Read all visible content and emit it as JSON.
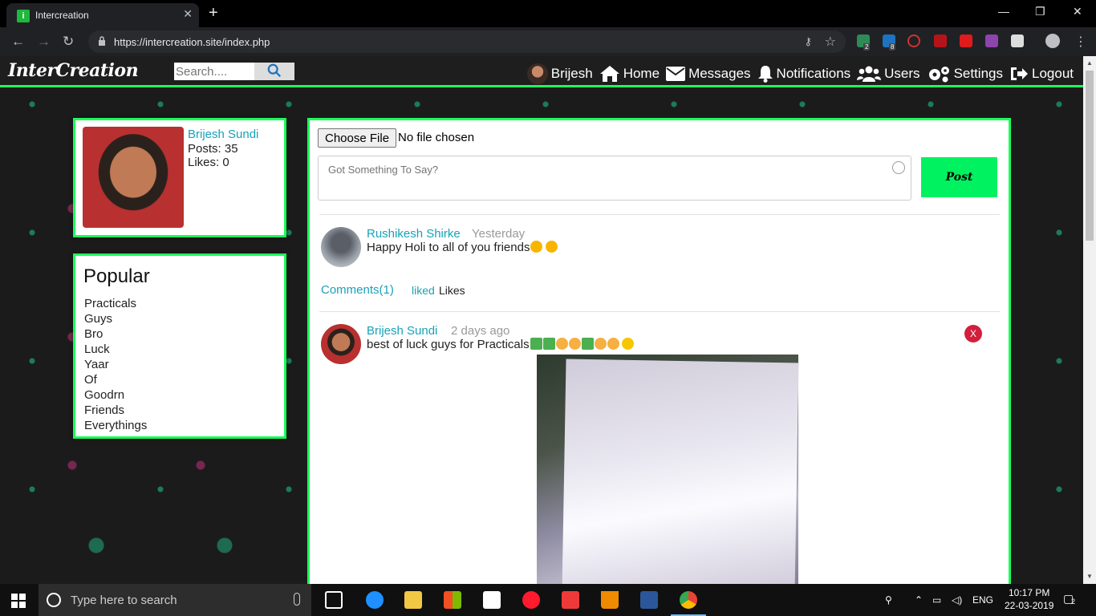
{
  "browser": {
    "tab_title": "Intercreation",
    "favicon_letter": "i",
    "url": "https://intercreation.site/index.php",
    "tab_close": "✕",
    "new_tab": "+",
    "win_min": "—",
    "win_restore": "❐",
    "win_close": "✕",
    "back": "←",
    "forward": "→",
    "reload": "↻",
    "extension_badges": [
      "2",
      "8"
    ]
  },
  "navbar": {
    "brand": "InterCreation",
    "search_placeholder": "Search....",
    "items": [
      {
        "label": "Brijesh",
        "icon": "avatar"
      },
      {
        "label": "Home",
        "icon": "home-icon"
      },
      {
        "label": "Messages",
        "icon": "envelope-icon"
      },
      {
        "label": "Notifications",
        "icon": "bell-icon"
      },
      {
        "label": "Users",
        "icon": "users-icon"
      },
      {
        "label": "Settings",
        "icon": "cogs-icon"
      },
      {
        "label": "Logout",
        "icon": "logout-icon"
      }
    ]
  },
  "profile": {
    "name": "Brijesh Sundi",
    "posts": "Posts: 35",
    "likes": "Likes: 0"
  },
  "popular": {
    "title": "Popular",
    "items": [
      "Practicals",
      "Guys",
      "Bro",
      "Luck",
      "Yaar",
      "Of",
      "Goodrn",
      "Friends",
      "Everythings"
    ]
  },
  "composer": {
    "file_button": "Choose File",
    "file_status": "No file chosen",
    "placeholder": "Got Something To Say?",
    "post_button": "Post"
  },
  "posts": [
    {
      "author": "Rushikesh Shirke",
      "time": "Yesterday",
      "text": "Happy Holi to all of you friends",
      "emojis": [
        "heart-eyes-emoji",
        "heart-eyes-emoji"
      ],
      "comments_label": "Comments(1)",
      "liked_label": "liked",
      "likes_label": "Likes"
    },
    {
      "author": "Brijesh Sundi",
      "time": "2 days ago",
      "text": "best of luck guys for Practicals",
      "emojis": [
        "books-emoji",
        "books-emoji",
        "ok-hand-emoji",
        "wave-hand-emoji",
        "books-emoji",
        "pray-emoji",
        "pray-emoji",
        "sunglasses-emoji"
      ],
      "delete_label": "X"
    }
  ],
  "taskbar": {
    "search_text": "Type here to search",
    "language": "ENG",
    "time": "10:17 PM",
    "date": "22-03-2019",
    "notification_count": "2"
  },
  "colors": {
    "accent_green": "#1bff5a",
    "post_button": "#00f260",
    "link_teal": "#17a2b8",
    "delete_red": "#d21f3c"
  }
}
